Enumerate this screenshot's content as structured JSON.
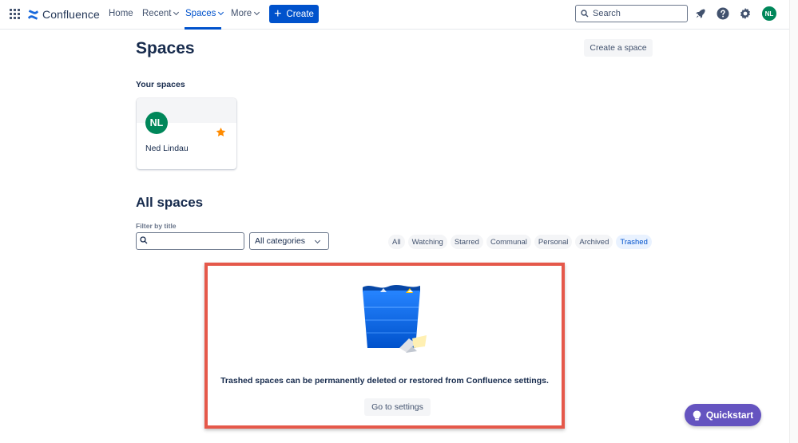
{
  "nav": {
    "brand": "Confluence",
    "home": "Home",
    "recent": "Recent",
    "spaces": "Spaces",
    "more": "More",
    "create": "Create",
    "search_placeholder": "Search",
    "user_initials": "NL",
    "icons": [
      "app-switcher-icon",
      "confluence-logo-icon",
      "notifications-icon",
      "help-icon",
      "settings-icon"
    ]
  },
  "page": {
    "title": "Spaces",
    "create_space": "Create a space"
  },
  "your_spaces": {
    "heading": "Your spaces",
    "cards": [
      {
        "initials": "NL",
        "name": "Ned Lindau",
        "starred": true
      }
    ]
  },
  "all_spaces": {
    "heading": "All spaces",
    "filter_label": "Filter by title",
    "filter_value": "",
    "category_selected": "All categories",
    "tabs": [
      "All",
      "Watching",
      "Starred",
      "Communal",
      "Personal",
      "Archived",
      "Trashed"
    ],
    "active_tab": "Trashed"
  },
  "empty_state": {
    "message": "Trashed spaces can be permanently deleted or restored from Confluence settings.",
    "button": "Go to settings"
  },
  "quickstart": "Quickstart",
  "colors": {
    "primary": "#0052cc",
    "avatar": "#00875a",
    "star": "#ff8b00",
    "quickstart": "#6554c0",
    "highlight_border": "#e5584a"
  }
}
